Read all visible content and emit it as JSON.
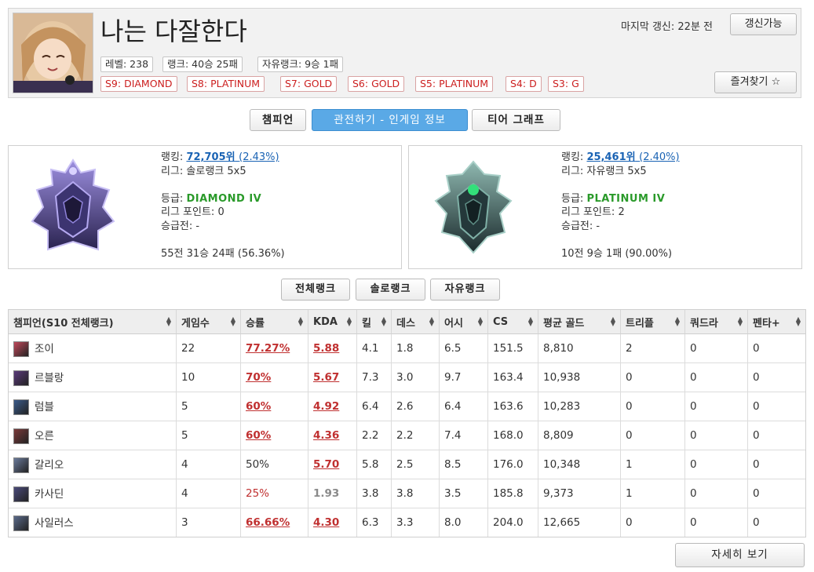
{
  "profile": {
    "name": "나는 다잘한다",
    "level": "레벨: 238",
    "rank_record": "랭크: 40승 25패",
    "flex_record": "자유랭크: 9승 1패",
    "past_tiers": [
      "S9: DIAMOND",
      "S8: PLATINUM",
      "S7: GOLD",
      "S6: GOLD",
      "S5: PLATINUM",
      "S4: D",
      "S3: G"
    ],
    "last_update": "마지막 갱신: 22분 전",
    "refresh_label": "갱신가능",
    "favorite_label": "즐겨찾기 ☆"
  },
  "tabs": [
    {
      "label": "챔피언",
      "active": false
    },
    {
      "label": "관전하기 - 인게임 정보",
      "active": true
    },
    {
      "label": "티어 그래프",
      "active": false
    }
  ],
  "ranks": [
    {
      "ranking_label": "랭킹:",
      "ranking": "72,705위",
      "ranking_pct": "(2.43%)",
      "league": "리그: 솔로랭크 5x5",
      "grade_label": "등급:",
      "grade": "DIAMOND IV",
      "league_points": "리그 포인트: 0",
      "promo": "승급전: -",
      "record": "55전 31승 24패 (56.36%)",
      "emblem": "diamond-emblem",
      "color": "#6a5bb8"
    },
    {
      "ranking_label": "랭킹:",
      "ranking": "25,461위",
      "ranking_pct": "(2.40%)",
      "league": "리그: 자유랭크 5x5",
      "grade_label": "등급:",
      "grade": "PLATINUM IV",
      "league_points": "리그 포인트: 2",
      "promo": "승급전: -",
      "record": "10전 9승 1패 (90.00%)",
      "emblem": "platinum-emblem",
      "color": "#2f7a6a"
    }
  ],
  "rank_filters": [
    "전체랭크",
    "솔로랭크",
    "자유랭크"
  ],
  "table": {
    "headers": [
      "챔피언(S10 전체랭크)",
      "게임수",
      "승률",
      "KDA",
      "킬",
      "데스",
      "어시",
      "CS",
      "평균 골드",
      "트리플",
      "쿼드라",
      "펜타+"
    ],
    "rows": [
      {
        "champion": "조이",
        "icon_color": "#c0485a",
        "games": "22",
        "winrate": "77.27%",
        "wr_hl": true,
        "kda": "5.88",
        "kda_hl": true,
        "kills": "4.1",
        "deaths": "1.8",
        "assists": "6.5",
        "cs": "151.5",
        "gold": "8,810",
        "triple": "2",
        "quadra": "0",
        "penta": "0"
      },
      {
        "champion": "르블랑",
        "icon_color": "#5a3a7a",
        "games": "10",
        "winrate": "70%",
        "wr_hl": true,
        "kda": "5.67",
        "kda_hl": true,
        "kills": "7.3",
        "deaths": "3.0",
        "assists": "9.7",
        "cs": "163.4",
        "gold": "10,938",
        "triple": "0",
        "quadra": "0",
        "penta": "0"
      },
      {
        "champion": "럼블",
        "icon_color": "#3a5a8a",
        "games": "5",
        "winrate": "60%",
        "wr_hl": true,
        "kda": "4.92",
        "kda_hl": true,
        "kills": "6.4",
        "deaths": "2.6",
        "assists": "6.4",
        "cs": "163.6",
        "gold": "10,283",
        "triple": "0",
        "quadra": "0",
        "penta": "0"
      },
      {
        "champion": "오른",
        "icon_color": "#7a3a3a",
        "games": "5",
        "winrate": "60%",
        "wr_hl": true,
        "kda": "4.36",
        "kda_hl": true,
        "kills": "2.2",
        "deaths": "2.2",
        "assists": "7.4",
        "cs": "168.0",
        "gold": "8,809",
        "triple": "0",
        "quadra": "0",
        "penta": "0"
      },
      {
        "champion": "갈리오",
        "icon_color": "#6a7a9a",
        "games": "4",
        "winrate": "50%",
        "wr_hl": false,
        "kda": "5.70",
        "kda_hl": true,
        "kills": "5.8",
        "deaths": "2.5",
        "assists": "8.5",
        "cs": "176.0",
        "gold": "10,348",
        "triple": "1",
        "quadra": "0",
        "penta": "0"
      },
      {
        "champion": "카사딘",
        "icon_color": "#4a4a7a",
        "games": "4",
        "winrate": "25%",
        "wr_hl": false,
        "wr_red": true,
        "kda": "1.93",
        "kda_hl": false,
        "kills": "3.8",
        "deaths": "3.8",
        "assists": "3.5",
        "cs": "185.8",
        "gold": "9,373",
        "triple": "1",
        "quadra": "0",
        "penta": "0"
      },
      {
        "champion": "사일러스",
        "icon_color": "#5a6a8a",
        "games": "3",
        "winrate": "66.66%",
        "wr_hl": true,
        "kda": "4.30",
        "kda_hl": true,
        "kills": "6.3",
        "deaths": "3.3",
        "assists": "8.0",
        "cs": "204.0",
        "gold": "12,665",
        "triple": "0",
        "quadra": "0",
        "penta": "0"
      }
    ]
  },
  "detail_label": "자세히 보기"
}
